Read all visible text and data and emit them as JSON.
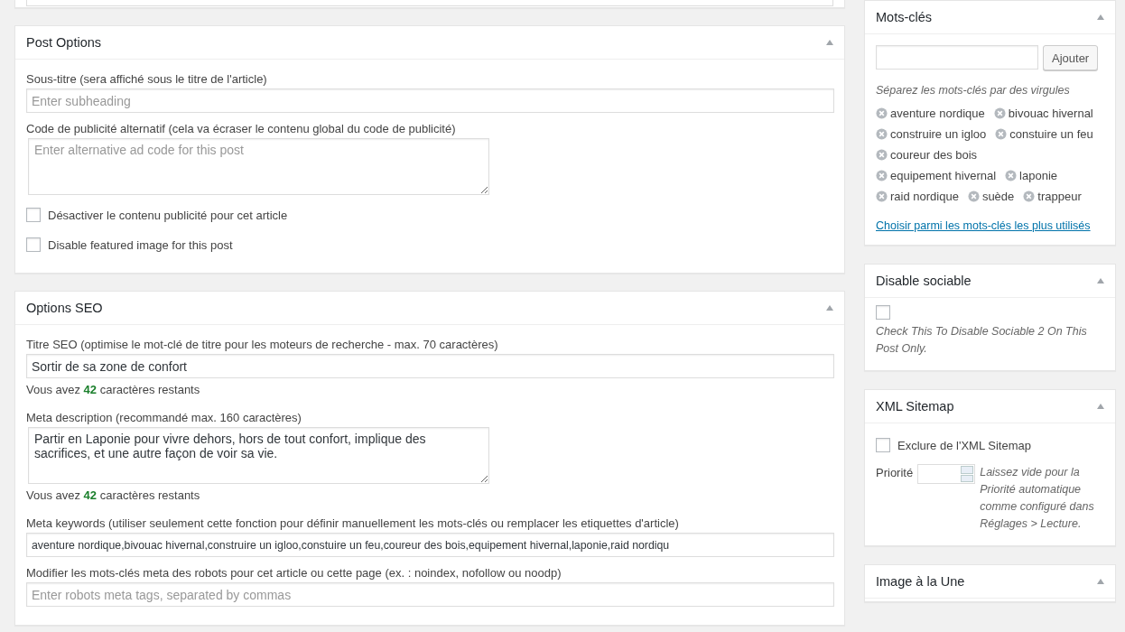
{
  "post_options": {
    "title": "Post Options",
    "fields": [
      {
        "kind": "text",
        "label": "Sous-titre (sera affiché sous le titre de l'article)",
        "placeholder": "Enter subheading"
      },
      {
        "kind": "textarea",
        "label": "Code de publicité alternatif (cela va écraser le contenu global du code de publicité)",
        "placeholder": "Enter alternative ad code for this post"
      },
      {
        "kind": "checkbox",
        "label": "Désactiver le contenu publicité pour cet article",
        "checked": false
      },
      {
        "kind": "checkbox",
        "label": "Disable featured image for this post",
        "checked": false
      }
    ]
  },
  "seo_options": {
    "title": "Options SEO",
    "fields": [
      {
        "kind": "text",
        "label": "Titre SEO (optimise le mot-clé de titre pour les moteurs de recherche - max. 70 caractères)",
        "value": "Sortir de sa zone de confort",
        "counter": {
          "before": "Vous avez",
          "count": "42",
          "after": "caractères restants"
        }
      },
      {
        "kind": "textarea",
        "label": "Meta description (recommandé max. 160 caractères)",
        "value": "Partir en Laponie pour vivre dehors, hors de tout confort, implique des sacrifices, et une autre façon de voir sa vie.",
        "counter": {
          "before": "Vous avez",
          "count": "42",
          "after": "caractères restants"
        }
      },
      {
        "kind": "text",
        "label": "Meta keywords (utiliser seulement cette fonction pour définir manuellement les mots-clés ou remplacer les etiquettes d'article)",
        "value": "aventure nordique,bivouac hivernal,construire un igloo,constuire un feu,coureur des bois,equipement hivernal,laponie,raid nordiqu"
      },
      {
        "kind": "text",
        "label": "Modifier les mots-clés meta des robots pour cet article ou cette page (ex. : noindex, nofollow ou noodp)",
        "placeholder": "Enter robots meta tags, separated by commas"
      }
    ]
  },
  "tags_box": {
    "title": "Mots-clés",
    "add_button": "Ajouter",
    "hint": "Séparez les mots-clés par des virgules",
    "tags": [
      "aventure nordique",
      "bivouac hivernal",
      "construire un igloo",
      "constuire un feu",
      "coureur des bois",
      "equipement hivernal",
      "laponie",
      "raid nordique",
      "suède",
      "trappeur"
    ],
    "link": "Choisir parmi les mots-clés les plus utilisés"
  },
  "sociable_box": {
    "title": "Disable sociable",
    "checked": false,
    "note": "Check This To Disable Sociable 2 On This Post Only."
  },
  "sitemap_box": {
    "title": "XML Sitemap",
    "exclude_label": "Exclure de l'XML Sitemap",
    "exclude_checked": false,
    "priority_label": "Priorité",
    "priority_note": "Laissez vide pour la Priorité automatique comme configuré dans Réglages > Lecture."
  },
  "featured_box": {
    "title": "Image à la Une"
  }
}
